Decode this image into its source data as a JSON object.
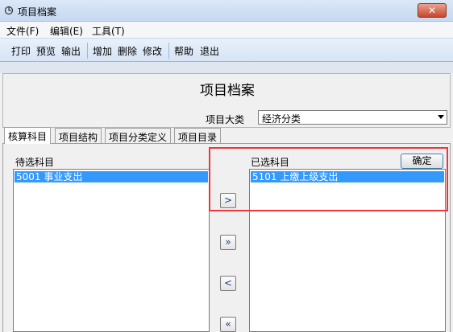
{
  "window": {
    "title": "项目档案",
    "close_label": "✕"
  },
  "menu": {
    "items": [
      "文件(F)",
      "编辑(E)",
      "工具(T)"
    ]
  },
  "toolbar": {
    "buttons": [
      "打印",
      "预览",
      "输出",
      "增加",
      "删除",
      "修改",
      "帮助",
      "退出"
    ]
  },
  "header": {
    "title": "项目档案",
    "category_label": "项目大类",
    "category_value": "经济分类"
  },
  "tabs": [
    {
      "label": "核算科目",
      "active": true
    },
    {
      "label": "项目结构",
      "active": false
    },
    {
      "label": "项目分类定义",
      "active": false
    },
    {
      "label": "项目目录",
      "active": false
    }
  ],
  "available": {
    "label": "待选科目",
    "items": [
      "5001 事业支出"
    ]
  },
  "selected": {
    "label": "已选科目",
    "items": [
      "5101 上缴上级支出"
    ]
  },
  "buttons": {
    "confirm": "确定",
    "add_one": ">",
    "add_all": "»",
    "remove_one": "<",
    "remove_all": "«"
  },
  "colors": {
    "selection": "#3399ff",
    "highlight": "#e8383d",
    "toolbar": "#d6e4f5"
  }
}
